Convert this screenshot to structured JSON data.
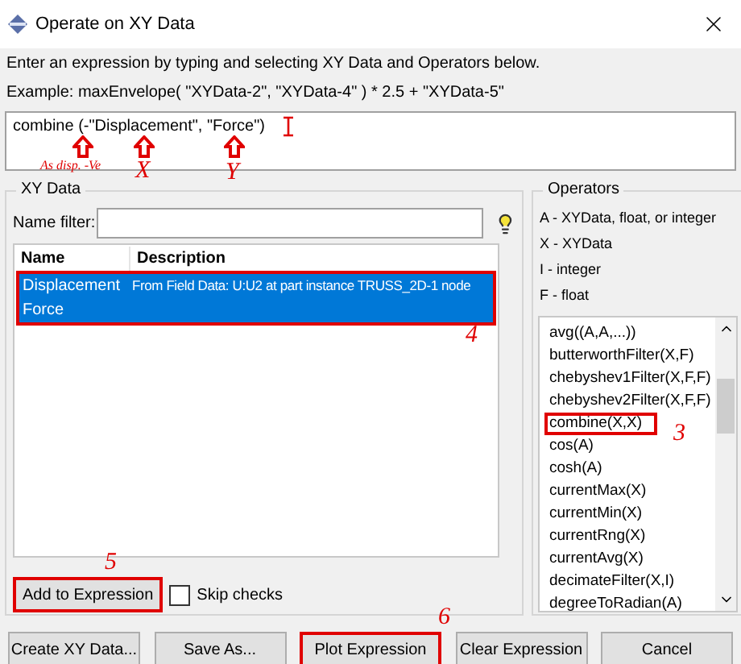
{
  "window": {
    "title": "Operate on XY Data"
  },
  "instructions": [
    "Enter an expression by typing and selecting XY Data and Operators below.",
    "Example: maxEnvelope( \"XYData-2\", \"XYData-4\" ) * 2.5 + \"XYData-5\""
  ],
  "expression": {
    "value": "combine (-\"Displacement\", \"Force\")"
  },
  "annotations": {
    "sign_note": "As disp. -Ve",
    "x_label": "X",
    "y_label": "Y",
    "rows_marker": "4",
    "operator_marker": "3",
    "add_marker": "5",
    "plot_marker": "6"
  },
  "xy_data": {
    "title": "XY Data",
    "name_filter": {
      "label": "Name filter:"
    },
    "columns": [
      "Name",
      "Description"
    ],
    "rows_marked": true,
    "rows": [
      {
        "name": "Displacement",
        "description": "From Field Data: U:U2  at part instance TRUSS_2D-1 node",
        "selected": true
      },
      {
        "name": "Force",
        "description": "",
        "selected": true
      }
    ],
    "add_button": {
      "label": "Add to Expression",
      "marked": true
    },
    "skip_checks": {
      "label": "Skip checks",
      "checked": false
    }
  },
  "operators": {
    "title": "Operators",
    "legend": [
      "A - XYData, float, or integer",
      "X - XYData",
      "I - integer",
      "F - float"
    ],
    "items": [
      {
        "label": "avg((A,A,...))",
        "marked": false
      },
      {
        "label": "butterworthFilter(X,F)",
        "marked": false
      },
      {
        "label": "chebyshev1Filter(X,F,F)",
        "marked": false
      },
      {
        "label": "chebyshev2Filter(X,F,F)",
        "marked": false
      },
      {
        "label": "combine(X,X)",
        "marked": true
      },
      {
        "label": "cos(A)",
        "marked": false
      },
      {
        "label": "cosh(A)",
        "marked": false
      },
      {
        "label": "currentMax(X)",
        "marked": false
      },
      {
        "label": "currentMin(X)",
        "marked": false
      },
      {
        "label": "currentRng(X)",
        "marked": false
      },
      {
        "label": "currentAvg(X)",
        "marked": false
      },
      {
        "label": "decimateFilter(X,I)",
        "marked": false
      },
      {
        "label": "degreeToRadian(A)",
        "marked": false
      }
    ]
  },
  "buttons": [
    {
      "label": "Create XY Data...",
      "marked": false
    },
    {
      "label": "Save As...",
      "marked": false
    },
    {
      "label": "Plot Expression",
      "marked": true
    },
    {
      "label": "Clear Expression",
      "marked": false
    },
    {
      "label": "Cancel",
      "marked": false
    }
  ]
}
